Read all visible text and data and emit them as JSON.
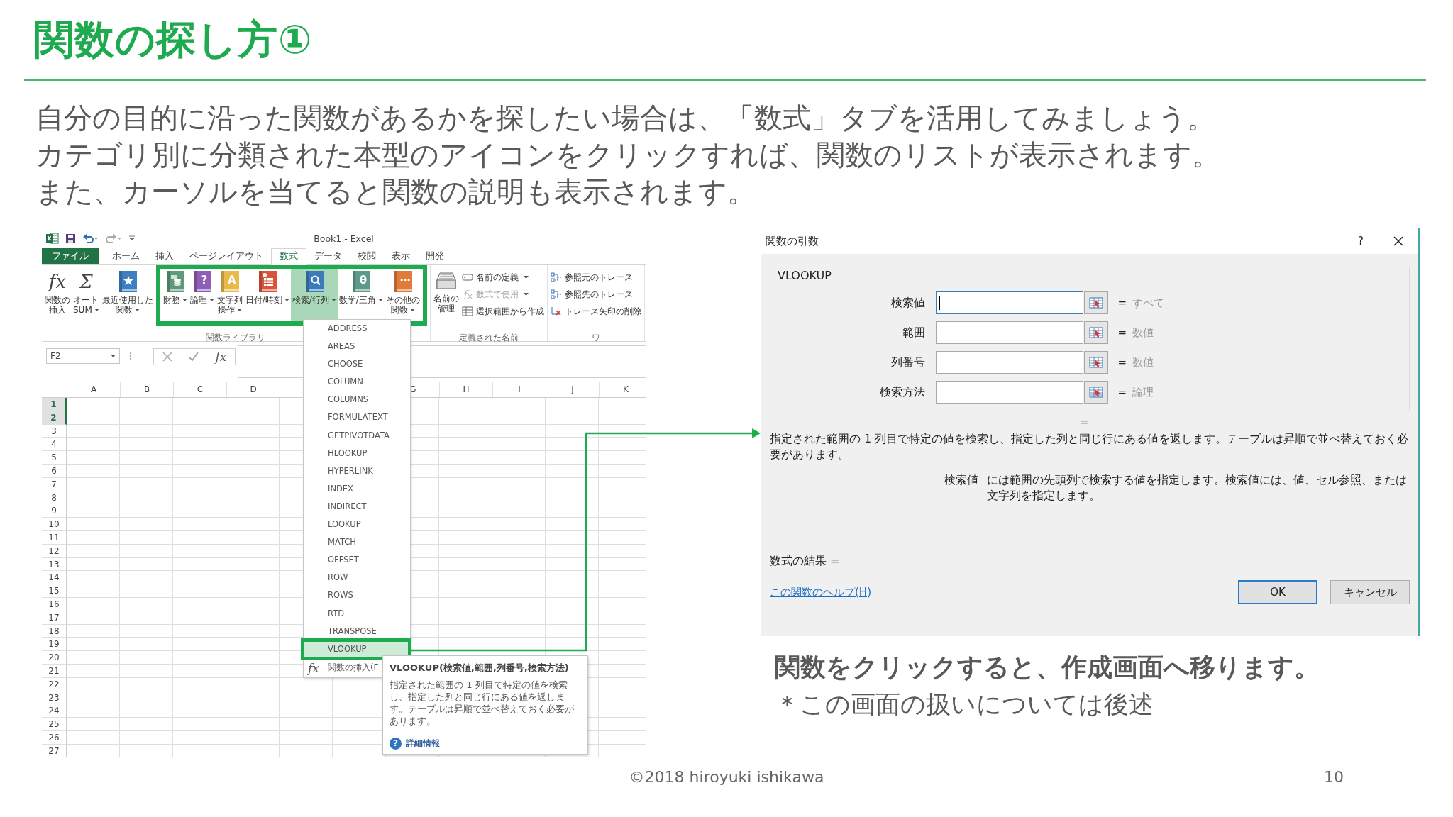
{
  "slide": {
    "title": "関数の探し方①",
    "body": [
      "自分の目的に沿った関数があるかを探したい場合は、「数式」タブを活用してみましょう。",
      "カテゴリ別に分類された本型のアイコンをクリックすれば、関数のリストが表示されます。",
      "また、カーソルを当てると関数の説明も表示されます。"
    ]
  },
  "excel": {
    "window_title": "Book1 - Excel",
    "tabs": [
      {
        "label": "ファイル",
        "kind": "file",
        "selected": false
      },
      {
        "label": "ホーム",
        "kind": "tab",
        "selected": false
      },
      {
        "label": "挿入",
        "kind": "tab",
        "selected": false
      },
      {
        "label": "ページレイアウト",
        "kind": "tab",
        "selected": false
      },
      {
        "label": "数式",
        "kind": "tab",
        "selected": true
      },
      {
        "label": "データ",
        "kind": "tab",
        "selected": false
      },
      {
        "label": "校閲",
        "kind": "tab",
        "selected": false
      },
      {
        "label": "表示",
        "kind": "tab",
        "selected": false
      },
      {
        "label": "開発",
        "kind": "tab",
        "selected": false
      }
    ],
    "ribbon_groups": [
      {
        "label": "関数ライブラリ",
        "buttons": [
          {
            "kind": "glyph",
            "glyph": "fx",
            "label": [
              "関数の",
              "挿入"
            ],
            "dropdown": false,
            "selected": false
          },
          {
            "kind": "glyph",
            "glyph": "Σ",
            "label": [
              "オート",
              "SUM"
            ],
            "dropdown": true,
            "selected": false
          },
          {
            "kind": "book-star",
            "color": "#3f7fc0",
            "label": [
              "最近使用した",
              "関数"
            ],
            "dropdown": true,
            "selected": false
          }
        ],
        "highlighted_buttons": [
          {
            "kind": "book-coins",
            "color": "#5e9a78",
            "label": [
              "財務"
            ],
            "dropdown": true,
            "selected": false
          },
          {
            "kind": "book-glyph",
            "glyph": "?",
            "color": "#8e5fb5",
            "label": [
              "論理"
            ],
            "dropdown": true,
            "selected": false
          },
          {
            "kind": "book-glyph",
            "glyph": "A",
            "color": "#e9b94c",
            "label": [
              "文字列",
              "操作"
            ],
            "dropdown": true,
            "selected": false
          },
          {
            "kind": "book-calendar",
            "color": "#d9553a",
            "label": [
              "日付/時刻"
            ],
            "dropdown": true,
            "selected": false
          },
          {
            "kind": "book-search",
            "color": "#3d7ab8",
            "label": [
              "検索/行列"
            ],
            "dropdown": true,
            "selected": true
          },
          {
            "kind": "book-glyph",
            "glyph": "θ",
            "color": "#5e9a8a",
            "label": [
              "数学/三角"
            ],
            "dropdown": true,
            "selected": false
          },
          {
            "kind": "book-glyph",
            "glyph": "⋯",
            "color": "#e07b39",
            "label": [
              "その他の",
              "関数"
            ],
            "dropdown": true,
            "selected": false
          }
        ]
      },
      {
        "label": "定義された名前",
        "buttons": [
          {
            "kind": "cards",
            "label": [
              "名前の",
              "管理"
            ],
            "dropdown": false,
            "selected": false
          }
        ],
        "small_items": [
          {
            "kind": "tag",
            "label": "名前の定義",
            "dropdown": true,
            "disabled": false
          },
          {
            "kind": "formula",
            "label": "数式で使用",
            "dropdown": true,
            "disabled": true
          },
          {
            "kind": "table",
            "label": "選択範囲から作成",
            "dropdown": false,
            "disabled": false
          }
        ]
      },
      {
        "label": "ワ",
        "small_items": [
          {
            "kind": "trace",
            "label": "参照元のトレース",
            "dropdown": false,
            "disabled": false
          },
          {
            "kind": "trace",
            "label": "参照先のトレース",
            "dropdown": false,
            "disabled": false
          },
          {
            "kind": "remove",
            "label": "トレース矢印の削除",
            "dropdown": false,
            "disabled": false
          }
        ]
      }
    ],
    "name_box": "F2",
    "formula_glyph": "fx",
    "columns": [
      "A",
      "B",
      "C",
      "D",
      "G",
      "H",
      "I",
      "J",
      "K"
    ],
    "rows": [
      {
        "label": "1",
        "selected": true
      },
      {
        "label": "2",
        "selected": true
      },
      {
        "label": "3",
        "selected": false
      },
      {
        "label": "4",
        "selected": false
      },
      {
        "label": "5",
        "selected": false
      },
      {
        "label": "6",
        "selected": false
      },
      {
        "label": "7",
        "selected": false
      },
      {
        "label": "8",
        "selected": false
      },
      {
        "label": "9",
        "selected": false
      },
      {
        "label": "10",
        "selected": false
      },
      {
        "label": "11",
        "selected": false
      },
      {
        "label": "12",
        "selected": false
      },
      {
        "label": "13",
        "selected": false
      },
      {
        "label": "14",
        "selected": false
      },
      {
        "label": "15",
        "selected": false
      },
      {
        "label": "16",
        "selected": false
      },
      {
        "label": "17",
        "selected": false
      },
      {
        "label": "18",
        "selected": false
      },
      {
        "label": "19",
        "selected": false
      },
      {
        "label": "20",
        "selected": false
      },
      {
        "label": "21",
        "selected": false
      },
      {
        "label": "22",
        "selected": false
      },
      {
        "label": "23",
        "selected": false
      },
      {
        "label": "24",
        "selected": false
      },
      {
        "label": "25",
        "selected": false
      },
      {
        "label": "26",
        "selected": false
      },
      {
        "label": "27",
        "selected": false
      }
    ],
    "function_menu": {
      "items": [
        {
          "label": "ADDRESS",
          "selected": false
        },
        {
          "label": "AREAS",
          "selected": false
        },
        {
          "label": "CHOOSE",
          "selected": false
        },
        {
          "label": "COLUMN",
          "selected": false
        },
        {
          "label": "COLUMNS",
          "selected": false
        },
        {
          "label": "FORMULATEXT",
          "selected": false
        },
        {
          "label": "GETPIVOTDATA",
          "selected": false
        },
        {
          "label": "HLOOKUP",
          "selected": false
        },
        {
          "label": "HYPERLINK",
          "selected": false
        },
        {
          "label": "INDEX",
          "selected": false
        },
        {
          "label": "INDIRECT",
          "selected": false
        },
        {
          "label": "LOOKUP",
          "selected": false
        },
        {
          "label": "MATCH",
          "selected": false
        },
        {
          "label": "OFFSET",
          "selected": false
        },
        {
          "label": "ROW",
          "selected": false
        },
        {
          "label": "ROWS",
          "selected": false
        },
        {
          "label": "RTD",
          "selected": false
        },
        {
          "label": "TRANSPOSE",
          "selected": false
        },
        {
          "label": "VLOOKUP",
          "selected": true
        }
      ],
      "insert_glyph": "fx",
      "insert_label": "関数の挿入(F"
    },
    "tooltip": {
      "title": "VLOOKUP(検索値,範囲,列番号,検索方法)",
      "body": "指定された範囲の 1 列目で特定の値を検索し、指定した列と同じ行にある値を返します。テーブルは昇順で並べ替えておく必要があります。",
      "help_glyph": "?",
      "link": "詳細情報"
    }
  },
  "dialog": {
    "title": "関数の引数",
    "help": "?",
    "function_name": "VLOOKUP",
    "arguments": [
      {
        "label": "検索値",
        "focused": true,
        "equals": "=",
        "hint": "すべて"
      },
      {
        "label": "範囲",
        "focused": false,
        "equals": "=",
        "hint": "数値"
      },
      {
        "label": "列番号",
        "focused": false,
        "equals": "=",
        "hint": "数値"
      },
      {
        "label": "検索方法",
        "focused": false,
        "equals": "=",
        "hint": "論理"
      }
    ],
    "result_equals": "=",
    "description": "指定された範囲の 1 列目で特定の値を検索し、指定した列と同じ行にある値を返します。テーブルは昇順で並べ替えておく必要があります。",
    "argument_help": {
      "name": "検索値",
      "text": "には範囲の先頭列で検索する値を指定します。検索値には、値、セル参照、または文字列を指定します。"
    },
    "formula_result": "数式の結果 =",
    "help_link": "この関数のヘルプ(H)",
    "buttons": [
      {
        "label": "OK",
        "default": true
      },
      {
        "label": "キャンセル",
        "default": false
      }
    ]
  },
  "caption": [
    "関数をクリックすると、作成画面へ移ります。",
    "＊この画面の扱いについては後述"
  ],
  "footer": {
    "copyright": "©2018 hiroyuki ishikawa",
    "page_number": "10"
  }
}
